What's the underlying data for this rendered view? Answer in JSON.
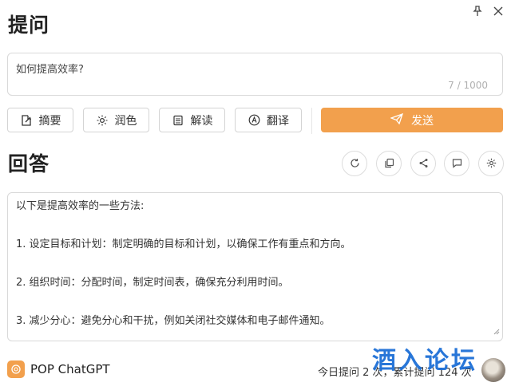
{
  "header": {
    "title": "提问",
    "pin_icon": "pin-icon",
    "close_icon": "close-icon"
  },
  "question": {
    "value": "如何提高效率?",
    "counter": "7 / 1000"
  },
  "actions": [
    {
      "label": "摘要",
      "icon": "summary-icon"
    },
    {
      "label": "润色",
      "icon": "sun-icon"
    },
    {
      "label": "解读",
      "icon": "list-icon"
    },
    {
      "label": "翻译",
      "icon": "translate-icon"
    }
  ],
  "send": {
    "label": "发送",
    "icon": "send-icon"
  },
  "answer": {
    "title": "回答",
    "tools": [
      "refresh-icon",
      "copy-icon",
      "share-icon",
      "comment-icon",
      "settings-icon"
    ],
    "lines": [
      "以下是提高效率的一些方法:",
      "1. 设定目标和计划：制定明确的目标和计划，以确保工作有重点和方向。",
      "2. 组织时间：分配时间，制定时间表，确保充分利用时间。",
      "3. 减少分心：避免分心和干扰，例如关闭社交媒体和电子邮件通知。"
    ]
  },
  "footer": {
    "brand": "POP ChatGPT",
    "stats": "今日提问 2 次，累计提问 124 次",
    "watermark": "酒入论坛"
  },
  "colors": {
    "accent": "#f2a04d",
    "watermark": "#1d6fd6",
    "border": "#d9d9d9"
  }
}
